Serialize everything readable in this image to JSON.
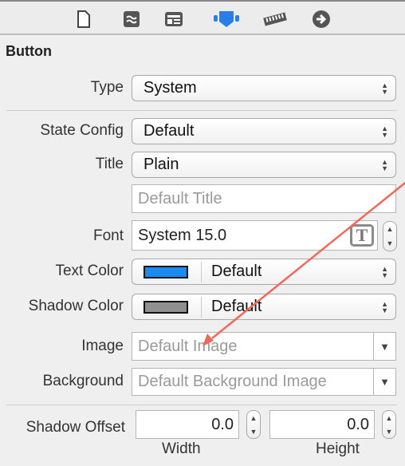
{
  "toolbar": {
    "icons": [
      "file-inspector-icon",
      "quick-help-icon",
      "identity-inspector-icon",
      "attributes-inspector-icon",
      "size-inspector-icon",
      "connections-inspector-icon"
    ],
    "active": "attributes-inspector-icon",
    "accent": "#2a7ee8"
  },
  "section_title": "Button",
  "type": {
    "label": "Type",
    "value": "System"
  },
  "state_config": {
    "label": "State Config",
    "value": "Default"
  },
  "title": {
    "label": "Title",
    "value": "Plain",
    "placeholder": "Default Title"
  },
  "font": {
    "label": "Font",
    "value": "System 15.0"
  },
  "text_color": {
    "label": "Text Color",
    "value": "Default",
    "swatch": "#1a8cf0"
  },
  "shadow_color": {
    "label": "Shadow Color",
    "value": "Default",
    "swatch": "#8f8f8f"
  },
  "image": {
    "label": "Image",
    "placeholder": "Default Image"
  },
  "background": {
    "label": "Background",
    "placeholder": "Default Background Image"
  },
  "shadow_offset": {
    "label": "Shadow Offset",
    "width": "0.0",
    "height": "0.0",
    "width_label": "Width",
    "height_label": "Height"
  },
  "annotation": {
    "color": "#f0685a"
  }
}
